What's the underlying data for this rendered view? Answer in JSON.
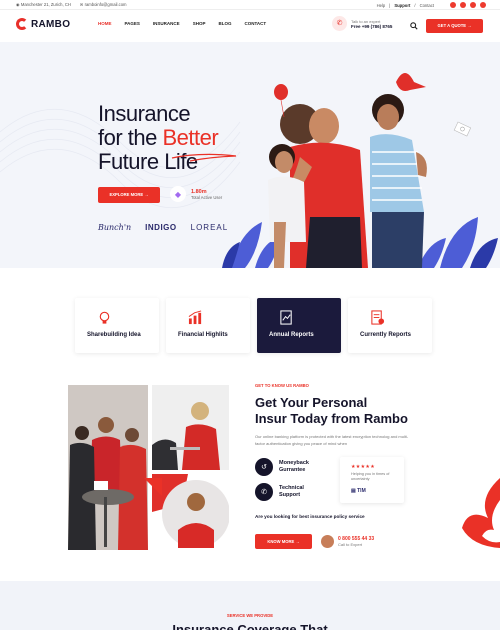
{
  "topbar": {
    "address": "Manchester 21, Zurich, CH",
    "email": "ramboinfo@gmail.com",
    "links": [
      "Help",
      "Support",
      "Contact"
    ]
  },
  "brand": {
    "name": "RAMBO",
    "accent": "#ea3127",
    "navy": "#15142a"
  },
  "nav": {
    "items": [
      "HOME",
      "PAGES",
      "INSURANCE",
      "SHOP",
      "BLOG",
      "CONTACT"
    ],
    "active": "HOME",
    "expert_label": "Talk to an expert",
    "expert_phone": "Free +99 (786) 8765",
    "quote_button": "GET A QUOTE"
  },
  "hero": {
    "line1": "Insurance",
    "line2_prefix": "for the ",
    "line2_highlight": "Better",
    "line3": "Future Life",
    "explore_button": "EXPLORE MORE",
    "stat_value": "1.80m",
    "stat_label": "Total Active User",
    "brands": [
      "Bunch'n",
      "INDIGO",
      "LOREAL"
    ]
  },
  "features": [
    {
      "label": "Sharebuilding Idea",
      "icon": "lightbulb-icon"
    },
    {
      "label": "Financial Highlits",
      "icon": "chart-icon"
    },
    {
      "label": "Annual Reports",
      "icon": "report-icon"
    },
    {
      "label": "Currently Reports",
      "icon": "document-icon"
    }
  ],
  "about": {
    "tag": "GET TO KNOW US RAMBO",
    "title_line1": "Get Your Personal",
    "title_line2": "Insur Today from Rambo",
    "para": "Our online banking platform is protected with the latest encryption technolog and multi-factor authentication giving you peace of mind when",
    "service1": "Moneyback Gurrantee",
    "service2": "Technical Support",
    "review_stars": "★★★★★",
    "review_text": "Helping you in times of uncertainty",
    "review_brand": "TIM",
    "question": "Are you looking for best insurance policy service",
    "know_button": "KNOW MORE",
    "call_number": "0 800 555 44 33",
    "call_label": "Call to Expert"
  },
  "services": {
    "tag": "SERVICE WE PROVIDE",
    "title": "Insurance Coverage That"
  }
}
